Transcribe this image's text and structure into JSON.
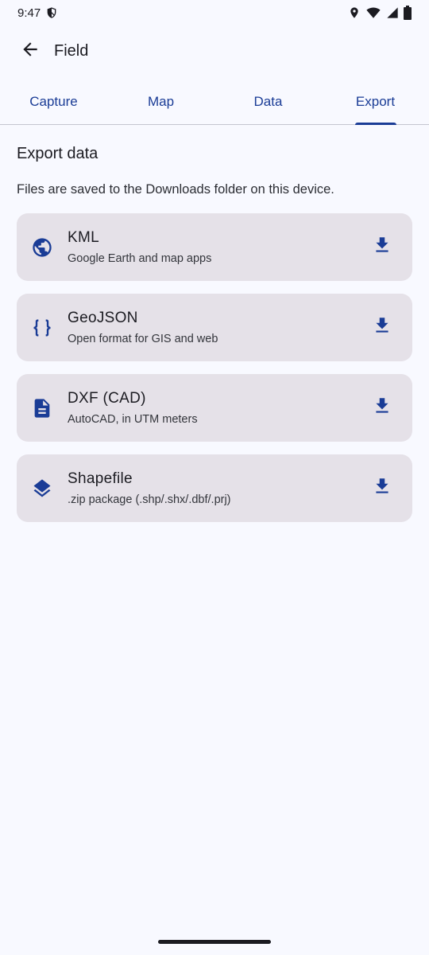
{
  "status_bar": {
    "time": "9:47",
    "icons": [
      "shield-icon",
      "location-icon",
      "wifi-icon",
      "signal-icon",
      "battery-icon"
    ]
  },
  "top_bar": {
    "title": "Field",
    "back_icon": "arrow-back-icon"
  },
  "tabs": [
    {
      "label": "Capture",
      "active": false
    },
    {
      "label": "Map",
      "active": false
    },
    {
      "label": "Data",
      "active": false
    },
    {
      "label": "Export",
      "active": true
    }
  ],
  "export": {
    "title": "Export data",
    "subtitle": "Files are saved to the Downloads folder on this device.",
    "items": [
      {
        "title": "KML",
        "description": "Google Earth and map apps",
        "icon": "globe-icon"
      },
      {
        "title": "GeoJSON",
        "description": "Open format for GIS and web",
        "icon": "braces-icon"
      },
      {
        "title": "DXF (CAD)",
        "description": "AutoCAD, in UTM meters",
        "icon": "document-icon"
      },
      {
        "title": "Shapefile",
        "description": ".zip package (.shp/.shx/.dbf/.prj)",
        "icon": "layers-icon"
      }
    ]
  },
  "colors": {
    "accent": "#1a3c96",
    "background": "#f8f9ff",
    "card": "#e5e1e8",
    "text": "#1b1b21"
  }
}
